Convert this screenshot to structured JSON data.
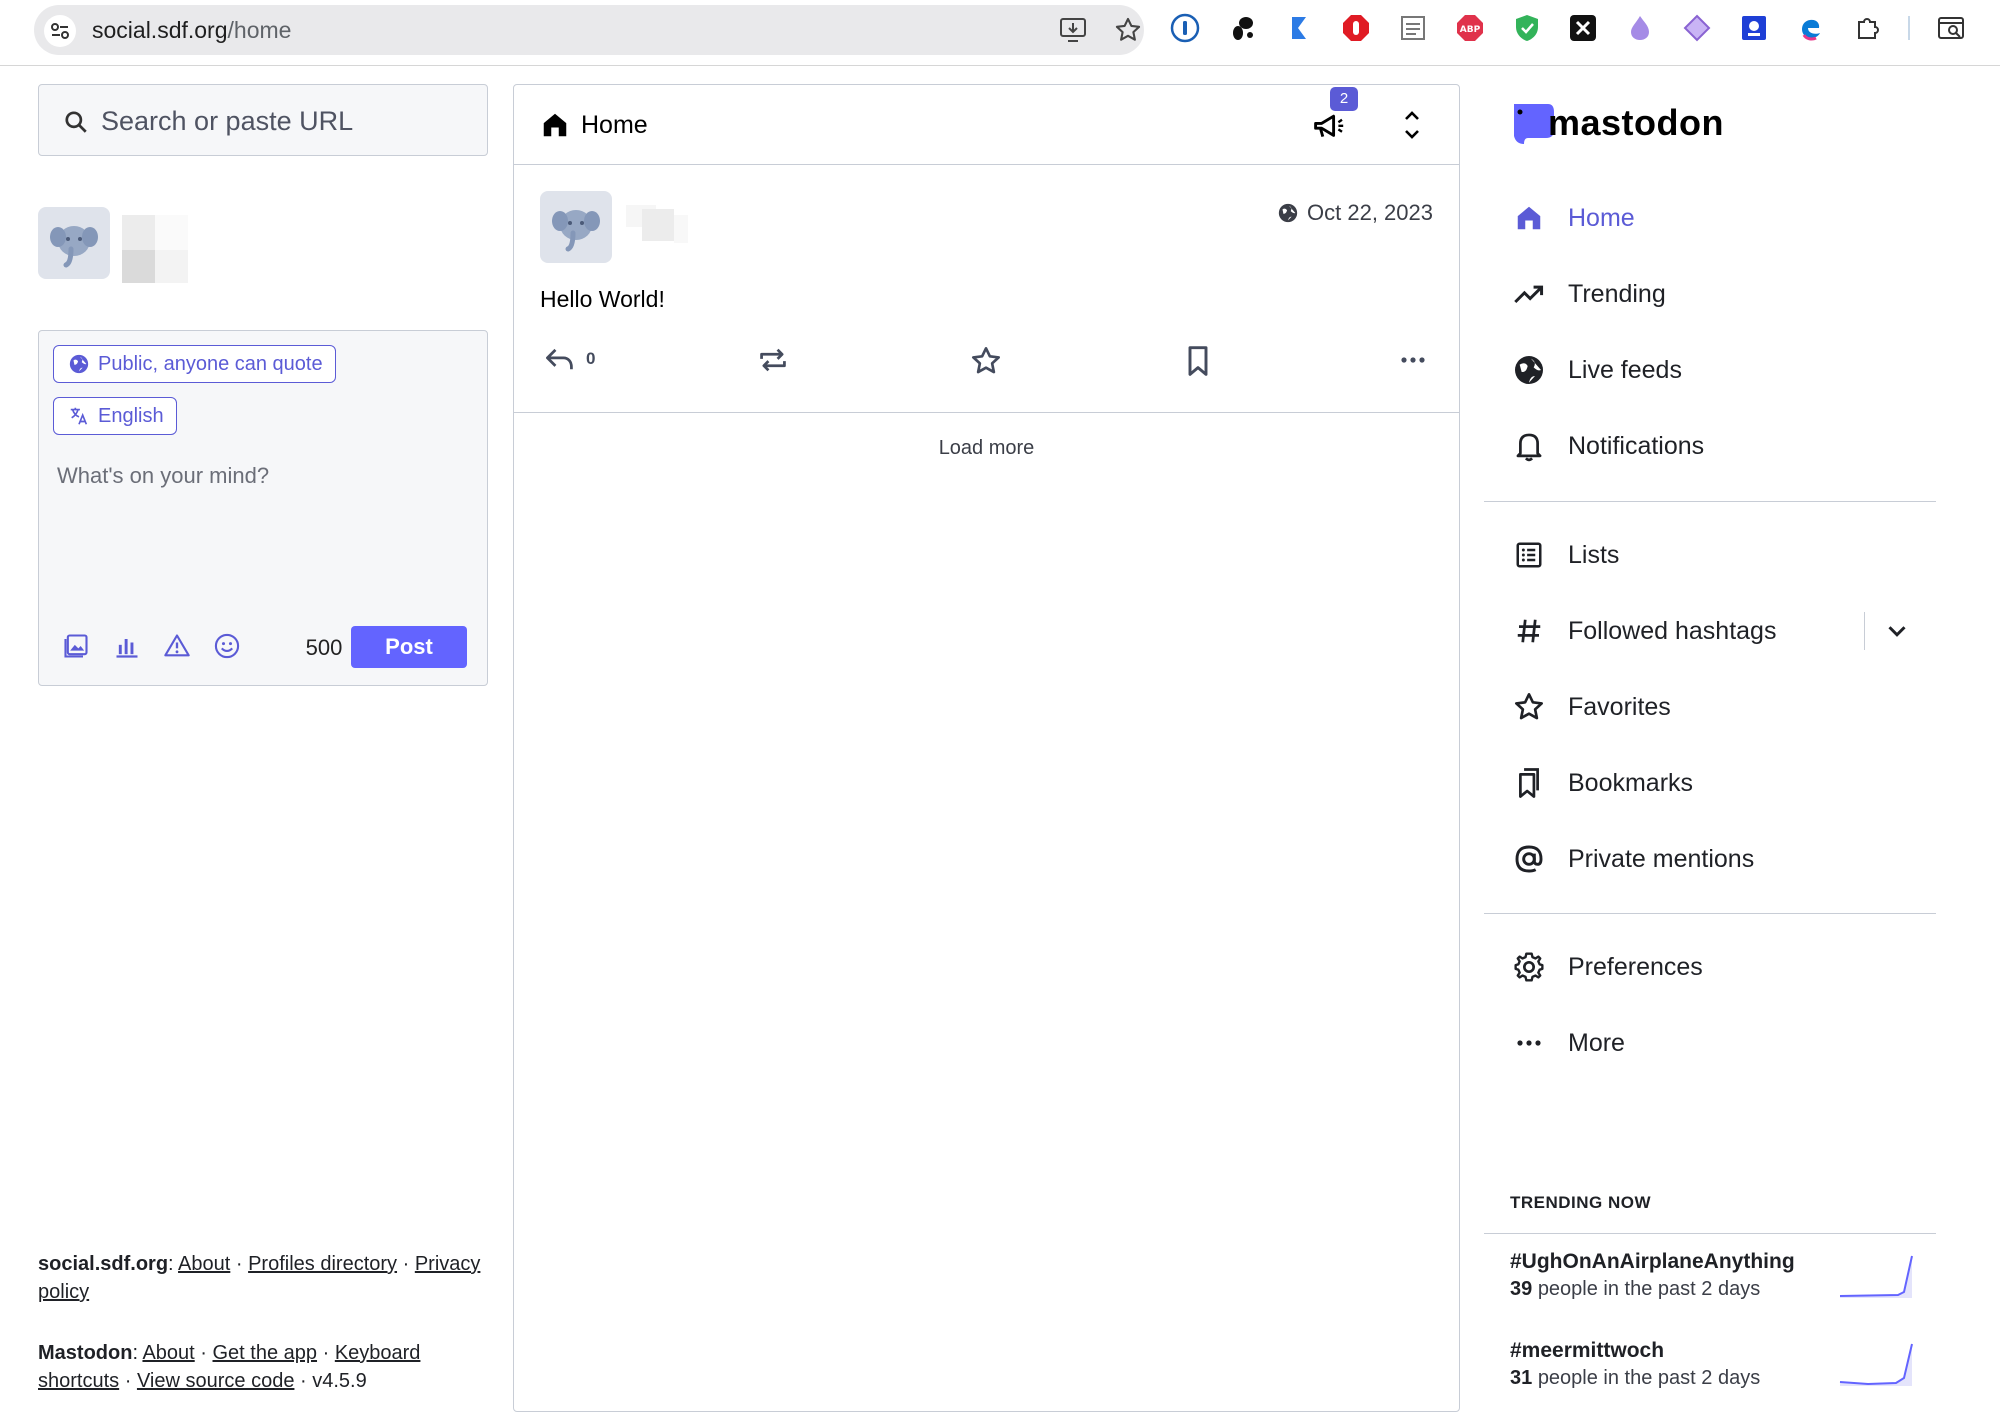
{
  "browser": {
    "url_host": "social.sdf.org",
    "url_path": "/home",
    "extensions": [
      "onepassword-icon",
      "gnome-icon",
      "kagi-icon",
      "stop-icon",
      "reader-icon",
      "adblock-icon",
      "shield-icon",
      "x-icon",
      "flame-icon",
      "diamond-icon",
      "badge-icon",
      "edge-icon",
      "puzzle-icon",
      "search-tab-icon"
    ]
  },
  "search": {
    "placeholder": "Search or paste URL"
  },
  "compose": {
    "visibility_label": "Public, anyone can quote",
    "language_label": "English",
    "placeholder": "What's on your mind?",
    "char_count": "500",
    "post_label": "Post"
  },
  "footer": {
    "server_name": "social.sdf.org",
    "server_links": [
      "About",
      "Profiles directory",
      "Privacy policy"
    ],
    "mastodon_name": "Mastodon",
    "mastodon_links": [
      "About",
      "Get the app",
      "Keyboard shortcuts",
      "View source code"
    ],
    "version": "v4.5.9"
  },
  "column": {
    "title": "Home",
    "announcement_count": "2"
  },
  "status": {
    "date": "Oct 22, 2023",
    "content": "Hello World!",
    "reply_count": "0"
  },
  "load_more": "Load more",
  "brand": {
    "name": "mastodon",
    "accent": "#6364ff"
  },
  "nav": {
    "home": "Home",
    "trending": "Trending",
    "live_feeds": "Live feeds",
    "notifications": "Notifications",
    "lists": "Lists",
    "followed_hashtags": "Followed hashtags",
    "favorites": "Favorites",
    "bookmarks": "Bookmarks",
    "private_mentions": "Private mentions",
    "preferences": "Preferences",
    "more": "More"
  },
  "trending": {
    "title": "TRENDING NOW",
    "items": [
      {
        "tag": "#UghOnAnAirplaneAnything",
        "count": "39",
        "suffix": "people in the past 2 days"
      },
      {
        "tag": "#meermittwoch",
        "count": "31",
        "suffix": "people in the past 2 days"
      }
    ]
  }
}
